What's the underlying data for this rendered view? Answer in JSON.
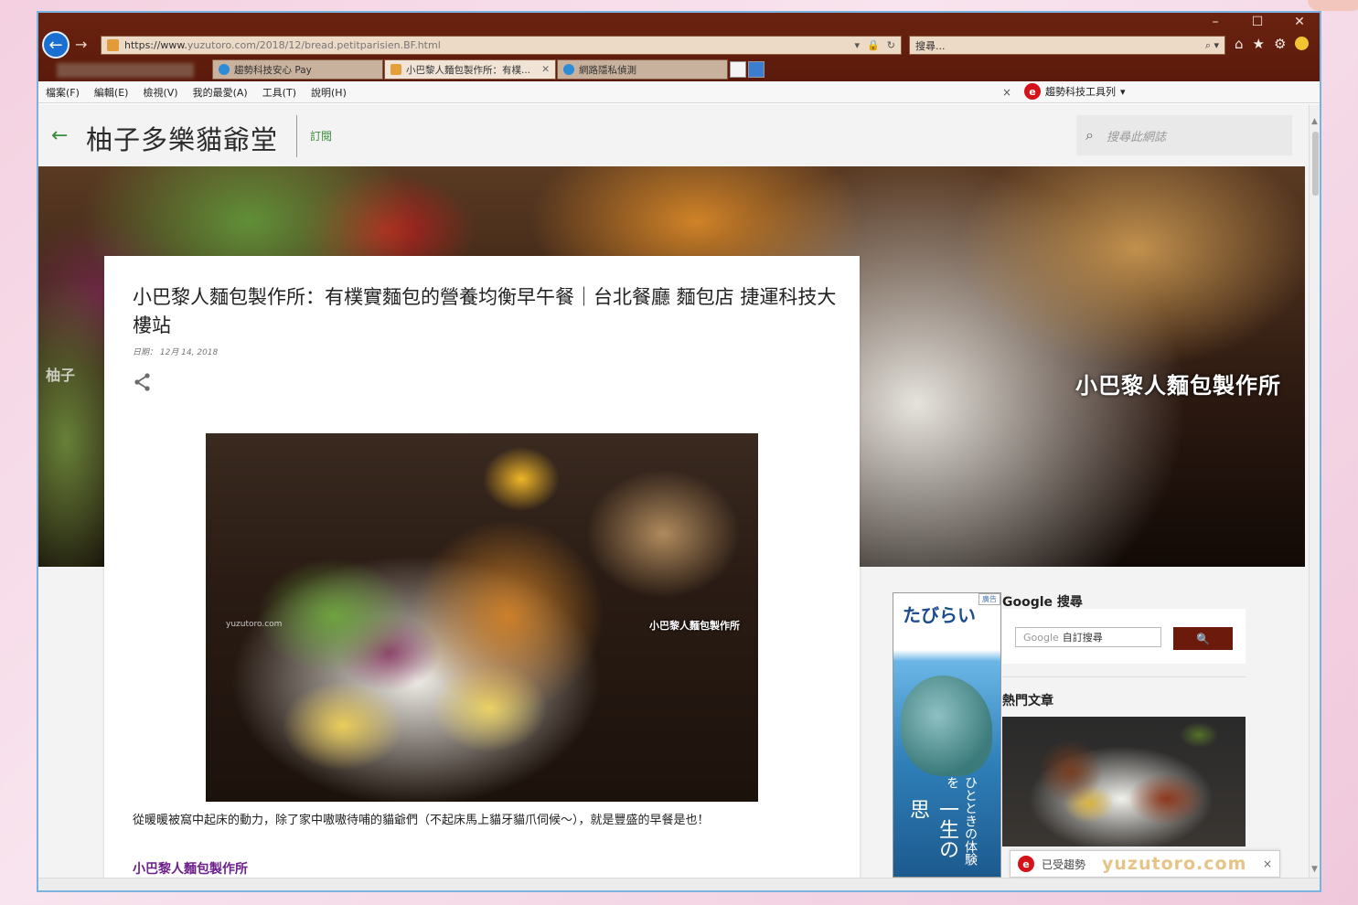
{
  "browser": {
    "address": {
      "scheme": "https://www.",
      "rest": "yuzutoro.com/2018/12/bread.petitparisien.BF.html"
    },
    "search_placeholder": "搜尋...",
    "window_controls": {
      "minimize": "–",
      "maximize": "☐",
      "close": "✕"
    },
    "tabs": [
      {
        "label": "趨勢科技安心 Pay",
        "active": false
      },
      {
        "label": "小巴黎人麵包製作所：有樸...",
        "active": true
      },
      {
        "label": "網路隱私偵測",
        "active": false
      }
    ],
    "menu": [
      "檔案(F)",
      "編輯(E)",
      "檢視(V)",
      "我的最愛(A)",
      "工具(T)",
      "說明(H)"
    ],
    "trend_toolbar": {
      "close": "×",
      "label": "趨勢科技工具列",
      "arrow": "▾"
    }
  },
  "blog": {
    "title": "柚子多樂貓爺堂",
    "subscribe": "訂閱",
    "search_placeholder": "搜尋此網誌",
    "hero_caption": "小巴黎人麵包製作所"
  },
  "post": {
    "title": "小巴黎人麵包製作所：有樸實麵包的營養均衡早午餐｜台北餐廳 麵包店 捷運科技大樓站",
    "date": "日期： 12月 14, 2018",
    "image_caption": "小巴黎人麵包製作所",
    "image_watermark": "yuzutoro.com",
    "body": "從暖暖被窩中起床的動力，除了家中嗷嗷待哺的貓爺們（不起床馬上貓牙貓爪伺候～），就是豐盛的早餐是也！",
    "subheading": "小巴黎人麵包製作所"
  },
  "ad": {
    "label": "廣告",
    "brand": "たびらい",
    "vertical": "ひとときの体験を",
    "big": "一生の思"
  },
  "sidebar": {
    "google_heading": "Google 搜尋",
    "google_input": "自訂搜尋",
    "google_brand": "Google",
    "google_button": "🔍",
    "popular_heading": "熱門文章"
  },
  "notification": {
    "text": "已受趨勢",
    "watermark": "yuzutoro.com",
    "close": "×"
  },
  "colors": {
    "chrome": "#5a1a0b",
    "accent_green": "#3d8b3d",
    "search_button": "#6b1a0b",
    "sub_link": "#6d1f8a"
  }
}
